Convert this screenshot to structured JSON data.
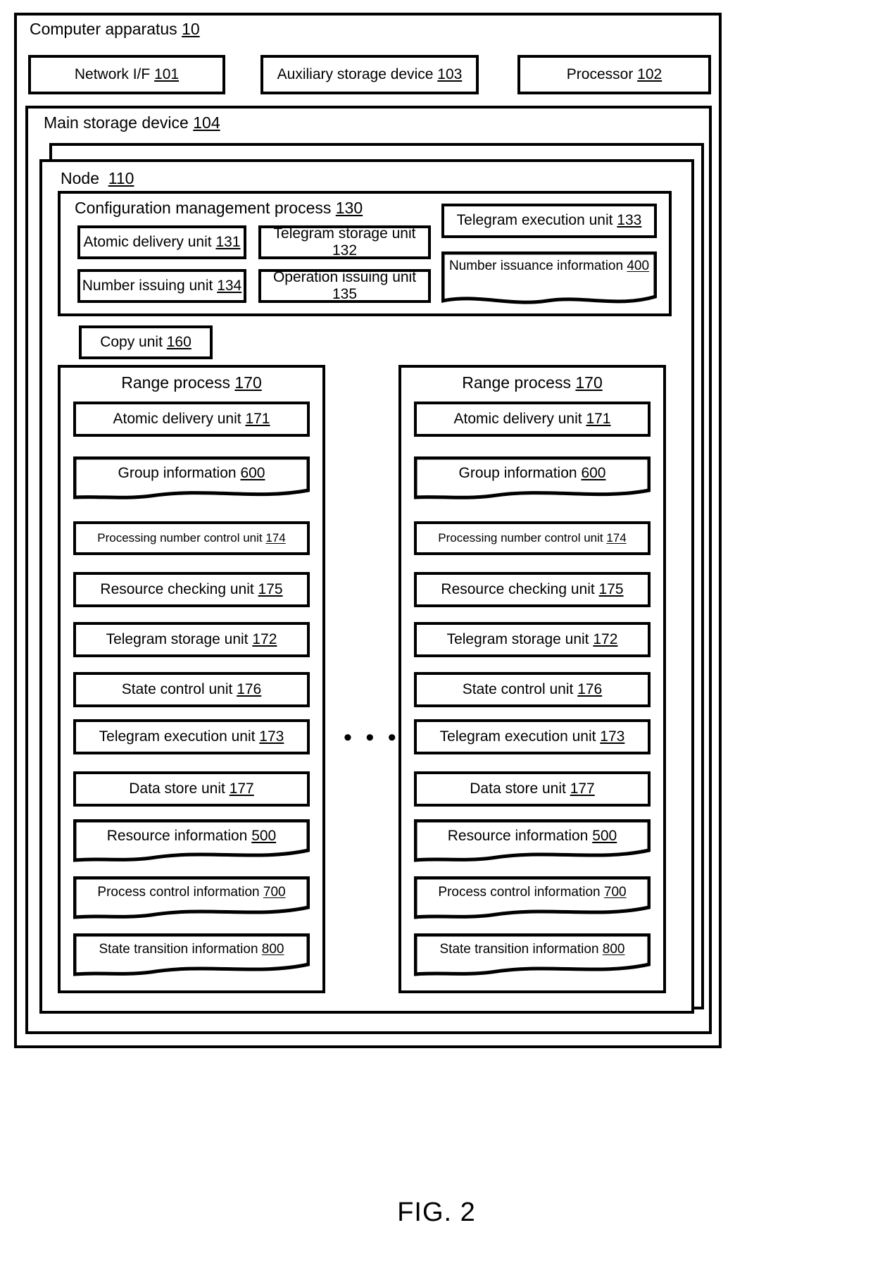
{
  "figure": {
    "caption": "FIG. 2",
    "ellipsis": "• • •"
  },
  "apparatus": {
    "label": "Computer apparatus 10",
    "label_text": "Computer apparatus",
    "label_ref": "10",
    "hardware": [
      {
        "name": "network-if",
        "text": "Network I/F",
        "ref": "101"
      },
      {
        "name": "auxiliary-storage-device",
        "text": "Auxiliary storage device",
        "ref": "103"
      },
      {
        "name": "processor",
        "text": "Processor",
        "ref": "102"
      }
    ]
  },
  "main_storage": {
    "label_text": "Main storage device",
    "label_ref": "104"
  },
  "node": {
    "label_text": "Node",
    "label_ref": "110"
  },
  "config_process": {
    "label_text": "Configuration management process",
    "label_ref": "130",
    "units": [
      {
        "name": "atomic-delivery-unit-131",
        "text": "Atomic delivery unit",
        "ref": "131",
        "shape": "rect"
      },
      {
        "name": "telegram-storage-unit-132",
        "text": "Telegram storage unit",
        "ref": "132",
        "shape": "rect"
      },
      {
        "name": "telegram-execution-unit-133",
        "text": "Telegram execution unit",
        "ref": "133",
        "shape": "rect"
      },
      {
        "name": "number-issuing-unit-134",
        "text": "Number issuing unit",
        "ref": "134",
        "shape": "rect"
      },
      {
        "name": "operation-issuing-unit-135",
        "text": "Operation issuing unit",
        "ref": "135",
        "shape": "rect"
      },
      {
        "name": "number-issuance-information-400",
        "text": "Number issuance information",
        "ref": "400",
        "shape": "data"
      }
    ]
  },
  "copy_unit": {
    "name": "copy-unit-160",
    "text": "Copy unit",
    "ref": "160"
  },
  "range_process": {
    "label_text": "Range process",
    "label_ref": "170",
    "items": [
      {
        "name": "atomic-delivery-unit-171",
        "text": "Atomic delivery unit",
        "ref": "171",
        "shape": "rect",
        "size": "normal"
      },
      {
        "name": "group-information-600",
        "text": "Group information",
        "ref": "600",
        "shape": "data",
        "size": "normal"
      },
      {
        "name": "processing-number-control-unit-174",
        "text": "Processing number control unit",
        "ref": "174",
        "shape": "rect",
        "size": "small"
      },
      {
        "name": "resource-checking-unit-175",
        "text": "Resource checking unit",
        "ref": "175",
        "shape": "rect",
        "size": "normal"
      },
      {
        "name": "telegram-storage-unit-172",
        "text": "Telegram storage unit",
        "ref": "172",
        "shape": "rect",
        "size": "normal"
      },
      {
        "name": "state-control-unit-176",
        "text": "State control unit",
        "ref": "176",
        "shape": "rect",
        "size": "normal"
      },
      {
        "name": "telegram-execution-unit-173",
        "text": "Telegram execution unit",
        "ref": "173",
        "shape": "rect",
        "size": "normal"
      },
      {
        "name": "data-store-unit-177",
        "text": "Data store unit",
        "ref": "177",
        "shape": "rect",
        "size": "normal"
      },
      {
        "name": "resource-information-500",
        "text": "Resource information",
        "ref": "500",
        "shape": "data",
        "size": "normal"
      },
      {
        "name": "process-control-information-700",
        "text": "Process control information",
        "ref": "700",
        "shape": "data",
        "size": "small"
      },
      {
        "name": "state-transition-information-800",
        "text": "State transition information",
        "ref": "800",
        "shape": "data",
        "size": "small"
      }
    ]
  },
  "labels": {
    "apparatus": "Computer apparatus 10",
    "network_if": "Network I/F 101",
    "aux_storage": "Auxiliary storage device 103",
    "processor": "Processor 102",
    "main_storage": "Main storage device 104",
    "node": "Node  110",
    "config_process": "Configuration management process 130",
    "copy_unit": "Copy unit 160",
    "range_process": "Range process 170"
  }
}
